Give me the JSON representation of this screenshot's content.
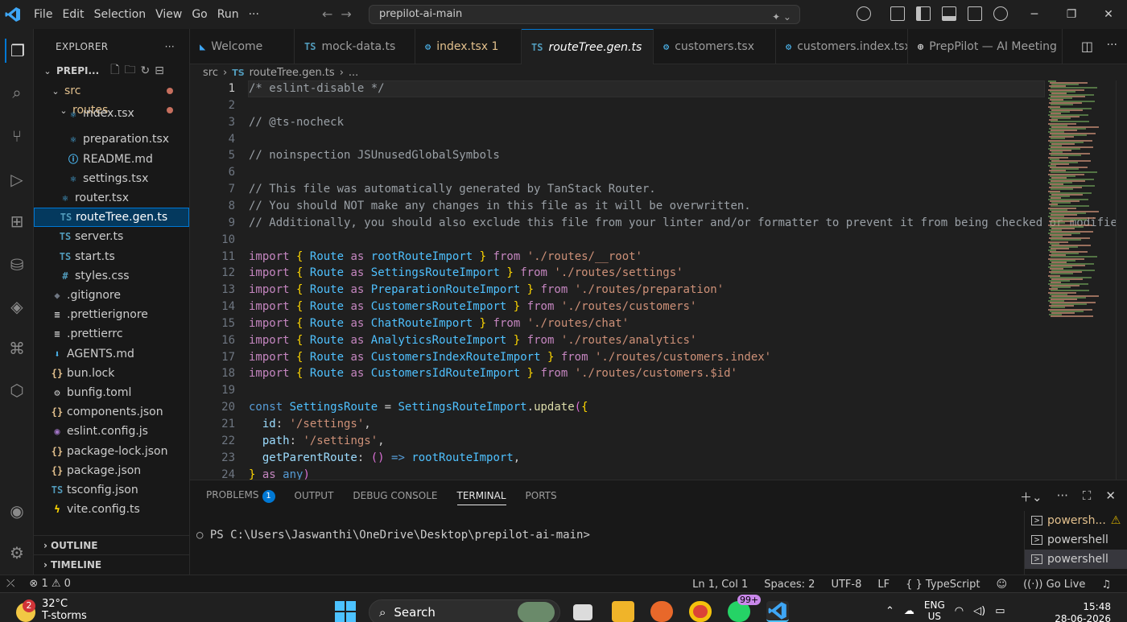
{
  "titlebar": {
    "menu": [
      "File",
      "Edit",
      "Selection",
      "View",
      "Go",
      "Run",
      "···"
    ],
    "search": "prepilot-ai-main"
  },
  "explorer": {
    "title": "EXPLORER",
    "project": "PREPI...",
    "tree": [
      {
        "label": "src",
        "icon": "chevron",
        "depth": 1,
        "kind": "folder-open",
        "color": "#e2c08d",
        "dot": true
      },
      {
        "label": "routes",
        "icon": "chevron",
        "depth": 2,
        "kind": "folder-open",
        "color": "#e2c08d",
        "dot": true
      },
      {
        "label": "index.tsx",
        "icon": "react",
        "depth": 3,
        "kind": "file",
        "color": "#cccccc",
        "partial": true
      },
      {
        "label": "preparation.tsx",
        "icon": "react",
        "depth": 3,
        "kind": "file",
        "color": "#cccccc"
      },
      {
        "label": "README.md",
        "icon": "info",
        "depth": 3,
        "kind": "file",
        "color": "#cccccc"
      },
      {
        "label": "settings.tsx",
        "icon": "react",
        "depth": 3,
        "kind": "file",
        "color": "#cccccc"
      },
      {
        "label": "router.tsx",
        "icon": "react",
        "depth": 2,
        "kind": "file",
        "color": "#cccccc"
      },
      {
        "label": "routeTree.gen.ts",
        "icon": "TS",
        "depth": 2,
        "kind": "file",
        "color": "#ffffff",
        "active": true
      },
      {
        "label": "server.ts",
        "icon": "TS",
        "depth": 2,
        "kind": "file",
        "color": "#cccccc"
      },
      {
        "label": "start.ts",
        "icon": "TS",
        "depth": 2,
        "kind": "file",
        "color": "#cccccc"
      },
      {
        "label": "styles.css",
        "icon": "#",
        "depth": 2,
        "kind": "file",
        "color": "#cccccc"
      },
      {
        "label": ".gitignore",
        "icon": "git",
        "depth": 1,
        "kind": "file",
        "color": "#cccccc"
      },
      {
        "label": ".prettierignore",
        "icon": "lines",
        "depth": 1,
        "kind": "file",
        "color": "#cccccc"
      },
      {
        "label": ".prettierrc",
        "icon": "lines",
        "depth": 1,
        "kind": "file",
        "color": "#cccccc"
      },
      {
        "label": "AGENTS.md",
        "icon": "down",
        "depth": 1,
        "kind": "file",
        "color": "#cccccc"
      },
      {
        "label": "bun.lock",
        "icon": "{}",
        "depth": 1,
        "kind": "file",
        "color": "#cccccc"
      },
      {
        "label": "bunfig.toml",
        "icon": "gear",
        "depth": 1,
        "kind": "file",
        "color": "#cccccc"
      },
      {
        "label": "components.json",
        "icon": "{}",
        "depth": 1,
        "kind": "file",
        "color": "#cccccc"
      },
      {
        "label": "eslint.config.js",
        "icon": "eslint",
        "depth": 1,
        "kind": "file",
        "color": "#cccccc"
      },
      {
        "label": "package-lock.json",
        "icon": "{}",
        "depth": 1,
        "kind": "file",
        "color": "#cccccc"
      },
      {
        "label": "package.json",
        "icon": "{}",
        "depth": 1,
        "kind": "file",
        "color": "#cccccc"
      },
      {
        "label": "tsconfig.json",
        "icon": "TS",
        "depth": 1,
        "kind": "file",
        "color": "#cccccc"
      },
      {
        "label": "vite.config.ts",
        "icon": "bolt",
        "depth": 1,
        "kind": "file",
        "color": "#cccccc"
      }
    ],
    "outline": "OUTLINE",
    "timeline": "TIMELINE"
  },
  "tabs": [
    {
      "label": "Welcome",
      "icon": "vscode"
    },
    {
      "label": "mock-data.ts",
      "icon": "TS"
    },
    {
      "label": "index.tsx 1",
      "icon": "react",
      "warn": true
    },
    {
      "label": "routeTree.gen.ts",
      "icon": "TS",
      "active": true
    },
    {
      "label": "customers.tsx",
      "icon": "react"
    },
    {
      "label": "customers.index.tsx",
      "icon": "react"
    },
    {
      "label": "PrepPilot — AI Meeting",
      "icon": "globe"
    }
  ],
  "breadcrumb": {
    "folder": "src",
    "file": "routeTree.gen.ts",
    "rest": "..."
  },
  "code": [
    "/* eslint-disable */",
    "",
    "// @ts-nocheck",
    "",
    "// noinspection JSUnusedGlobalSymbols",
    "",
    "// This file was automatically generated by TanStack Router.",
    "// You should NOT make any changes in this file as it will be overwritten.",
    "// Additionally, you should also exclude this file from your linter and/or formatter to prevent it from being checked or modified.",
    "",
    "import { Route as rootRouteImport } from './routes/__root'",
    "import { Route as SettingsRouteImport } from './routes/settings'",
    "import { Route as PreparationRouteImport } from './routes/preparation'",
    "import { Route as CustomersRouteImport } from './routes/customers'",
    "import { Route as ChatRouteImport } from './routes/chat'",
    "import { Route as AnalyticsRouteImport } from './routes/analytics'",
    "import { Route as CustomersIndexRouteImport } from './routes/customers.index'",
    "import { Route as CustomersIdRouteImport } from './routes/customers.$id'",
    "",
    "const SettingsRoute = SettingsRouteImport.update({",
    "  id: '/settings',",
    "  path: '/settings',",
    "  getParentRoute: () => rootRouteImport,",
    "} as any)"
  ],
  "panel": {
    "tabs": [
      "PROBLEMS",
      "OUTPUT",
      "DEBUG CONSOLE",
      "TERMINAL",
      "PORTS"
    ],
    "problems_count": "1",
    "prompt": "PS C:\\Users\\Jaswanthi\\OneDrive\\Desktop\\prepilot-ai-main>",
    "terminals": [
      "powersh...",
      "powershell",
      "powershell"
    ]
  },
  "status": {
    "errors": "1",
    "warnings": "0",
    "position": "Ln 1, Col 1",
    "spaces": "Spaces: 2",
    "encoding": "UTF-8",
    "eol": "LF",
    "language": "TypeScript",
    "golive": "Go Live"
  },
  "taskbar": {
    "weather_badge": "2",
    "temp": "32°C",
    "condition": "T-storms",
    "search": "Search",
    "whatsapp_badge": "99+",
    "lang1": "ENG",
    "lang2": "US",
    "time": "15:48",
    "date": "28-06-2026"
  }
}
